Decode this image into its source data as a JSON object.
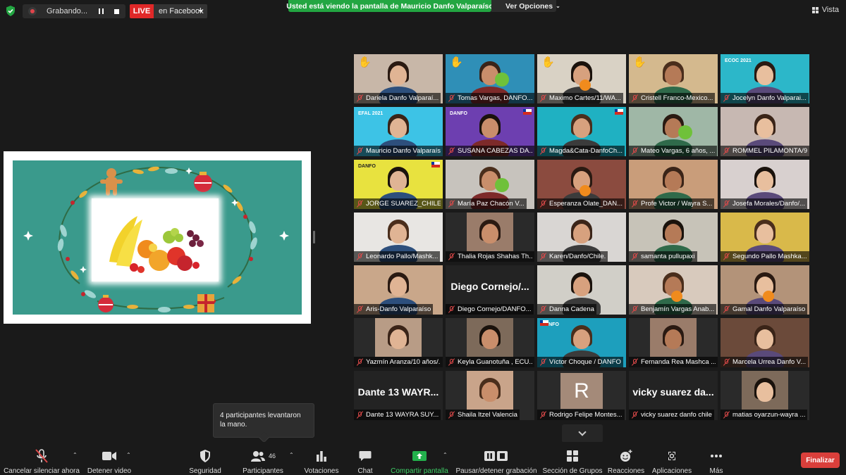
{
  "top_bar": {
    "recording_label": "Grabando...",
    "live_badge": "LIVE",
    "live_destination": "en Facebook",
    "share_banner": "Usted está viendo la pantalla de Mauricio Danfo Valparaíso",
    "view_options": "Ver Opciones",
    "view_button": "Vista"
  },
  "tiles": [
    {
      "name": "Dariela Danfo Valparaí...",
      "bg": "#c8b7a8"
    },
    {
      "name": "Tomas Vargas, DANFO...",
      "bg": "#2f8fb7"
    },
    {
      "name": "Maximo Cartes/11/WA...",
      "bg": "#d9d2c5"
    },
    {
      "name": "Cristell Franco-Mexico...",
      "bg": "#d4b98e"
    },
    {
      "name": "Jocelyn Danfo Valparai...",
      "bg": "#2cb7c9",
      "tile_text": "ECOC 2021"
    },
    {
      "name": "Mauricio Danfo Valparaíso",
      "bg": "#3dc3e6",
      "tile_text": "EFAL 2021"
    },
    {
      "name": "SUSANA CABEZAS DA...",
      "bg": "#6d3fb0",
      "tile_text": "DANFO"
    },
    {
      "name": "Magda&Cata-DanfoCh...",
      "bg": "#1fb1c2"
    },
    {
      "name": "Mateo Vargas, 6 años, ...",
      "bg": "#9fb7a6"
    },
    {
      "name": "ROMMEL PILAMONTA/9/...",
      "bg": "#c7b8b2"
    },
    {
      "name": "JORGE SUAREZ_CHILE DA...",
      "bg": "#e8e23f",
      "tile_text": "DANFO"
    },
    {
      "name": "María Paz Chacón V...",
      "bg": "#c7c3bd"
    },
    {
      "name": "Esperanza Olate_DAN...",
      "bg": "#8b4b3f"
    },
    {
      "name": "Profe Victor / Wayra S...",
      "bg": "#c99d7a"
    },
    {
      "name": "Josefa Morales/Danfo/...",
      "bg": "#d8d0cf"
    },
    {
      "name": "Leonardo Pallo/Mashk...",
      "bg": "#e8e6e3"
    },
    {
      "name": "Thalia Rojas Shahas Th...",
      "bg": "#2a2a2a"
    },
    {
      "name": "Karen/Danfo/Chile.",
      "bg": "#d9d6d3"
    },
    {
      "name": "samanta pullupaxi",
      "bg": "#c7c3b8"
    },
    {
      "name": "Segundo Pallo Mashka...",
      "bg": "#d9b94a"
    },
    {
      "name": "Aris-Danfo Valparaíso",
      "bg": "#c9a78a"
    },
    {
      "name": "Diego Cornejo/DANFO...",
      "bg": "#232323",
      "big_text": "Diego  Cornejo/..."
    },
    {
      "name": "Danna Cadena",
      "bg": "#d1cfc8"
    },
    {
      "name": "Benjamín Vargas Anab...",
      "bg": "#d8cabd"
    },
    {
      "name": "Gamal Danfo Valparaíso",
      "bg": "#b39379"
    },
    {
      "name": "Yazmín Aranza/10 años/...",
      "bg": "#2a2a2a"
    },
    {
      "name": "Keyla Guanotuña , ECU...",
      "bg": "#2a2a2a"
    },
    {
      "name": "Víctor Choque / DANFO",
      "bg": "#1d9fbd",
      "tile_text": "DANFO"
    },
    {
      "name": "Fernanda Rea Mashca ...",
      "bg": "#2a2a2a"
    },
    {
      "name": "Marcela Urrea Danfo V...",
      "bg": "#6b4a3a"
    },
    {
      "name": "Dante 13 WAYRA SUY...",
      "bg": "#232323",
      "big_text": "Dante 13  WAYR..."
    },
    {
      "name": "Shaila Itzel Valencia",
      "bg": "#2a2a2a"
    },
    {
      "name": "Rodrigo Felipe Montes...",
      "bg": "#2a2a2a",
      "avatar_letter": "R"
    },
    {
      "name": "vicky suarez danfo chile",
      "bg": "#232323",
      "big_text": "vicky  suarez  da..."
    },
    {
      "name": "matias oyarzun-wayra ...",
      "bg": "#2a2a2a"
    }
  ],
  "tooltip": "4 participantes levantaron la mano.",
  "toolbar": {
    "mute": "Cancelar silenciar ahora",
    "video": "Detener video",
    "security": "Seguridad",
    "participants": "Participantes",
    "participant_count": "46",
    "polls": "Votaciones",
    "chat": "Chat",
    "share": "Compartir pantalla",
    "record": "Pausar/detener grabación",
    "breakout": "Sección de Grupos",
    "reactions": "Reacciones",
    "apps": "Aplicaciones",
    "more": "Más",
    "end": "Finalizar"
  },
  "colors": {
    "share_green": "#23a642",
    "live_red": "#e02828",
    "end_red": "#d93f3b",
    "card_teal": "#3a9a8c",
    "active_outline": "#c7e53f"
  }
}
